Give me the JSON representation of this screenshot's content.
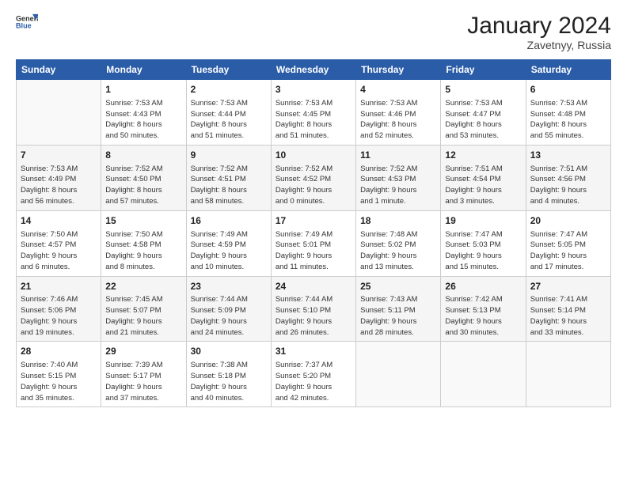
{
  "header": {
    "logo": {
      "general": "General",
      "blue": "Blue"
    },
    "title": "January 2024",
    "location": "Zavetnyy, Russia"
  },
  "columns": [
    "Sunday",
    "Monday",
    "Tuesday",
    "Wednesday",
    "Thursday",
    "Friday",
    "Saturday"
  ],
  "weeks": [
    [
      {
        "day": "",
        "info": ""
      },
      {
        "day": "1",
        "info": "Sunrise: 7:53 AM\nSunset: 4:43 PM\nDaylight: 8 hours\nand 50 minutes."
      },
      {
        "day": "2",
        "info": "Sunrise: 7:53 AM\nSunset: 4:44 PM\nDaylight: 8 hours\nand 51 minutes."
      },
      {
        "day": "3",
        "info": "Sunrise: 7:53 AM\nSunset: 4:45 PM\nDaylight: 8 hours\nand 51 minutes."
      },
      {
        "day": "4",
        "info": "Sunrise: 7:53 AM\nSunset: 4:46 PM\nDaylight: 8 hours\nand 52 minutes."
      },
      {
        "day": "5",
        "info": "Sunrise: 7:53 AM\nSunset: 4:47 PM\nDaylight: 8 hours\nand 53 minutes."
      },
      {
        "day": "6",
        "info": "Sunrise: 7:53 AM\nSunset: 4:48 PM\nDaylight: 8 hours\nand 55 minutes."
      }
    ],
    [
      {
        "day": "7",
        "info": "Sunrise: 7:53 AM\nSunset: 4:49 PM\nDaylight: 8 hours\nand 56 minutes."
      },
      {
        "day": "8",
        "info": "Sunrise: 7:52 AM\nSunset: 4:50 PM\nDaylight: 8 hours\nand 57 minutes."
      },
      {
        "day": "9",
        "info": "Sunrise: 7:52 AM\nSunset: 4:51 PM\nDaylight: 8 hours\nand 58 minutes."
      },
      {
        "day": "10",
        "info": "Sunrise: 7:52 AM\nSunset: 4:52 PM\nDaylight: 9 hours\nand 0 minutes."
      },
      {
        "day": "11",
        "info": "Sunrise: 7:52 AM\nSunset: 4:53 PM\nDaylight: 9 hours\nand 1 minute."
      },
      {
        "day": "12",
        "info": "Sunrise: 7:51 AM\nSunset: 4:54 PM\nDaylight: 9 hours\nand 3 minutes."
      },
      {
        "day": "13",
        "info": "Sunrise: 7:51 AM\nSunset: 4:56 PM\nDaylight: 9 hours\nand 4 minutes."
      }
    ],
    [
      {
        "day": "14",
        "info": "Sunrise: 7:50 AM\nSunset: 4:57 PM\nDaylight: 9 hours\nand 6 minutes."
      },
      {
        "day": "15",
        "info": "Sunrise: 7:50 AM\nSunset: 4:58 PM\nDaylight: 9 hours\nand 8 minutes."
      },
      {
        "day": "16",
        "info": "Sunrise: 7:49 AM\nSunset: 4:59 PM\nDaylight: 9 hours\nand 10 minutes."
      },
      {
        "day": "17",
        "info": "Sunrise: 7:49 AM\nSunset: 5:01 PM\nDaylight: 9 hours\nand 11 minutes."
      },
      {
        "day": "18",
        "info": "Sunrise: 7:48 AM\nSunset: 5:02 PM\nDaylight: 9 hours\nand 13 minutes."
      },
      {
        "day": "19",
        "info": "Sunrise: 7:47 AM\nSunset: 5:03 PM\nDaylight: 9 hours\nand 15 minutes."
      },
      {
        "day": "20",
        "info": "Sunrise: 7:47 AM\nSunset: 5:05 PM\nDaylight: 9 hours\nand 17 minutes."
      }
    ],
    [
      {
        "day": "21",
        "info": "Sunrise: 7:46 AM\nSunset: 5:06 PM\nDaylight: 9 hours\nand 19 minutes."
      },
      {
        "day": "22",
        "info": "Sunrise: 7:45 AM\nSunset: 5:07 PM\nDaylight: 9 hours\nand 21 minutes."
      },
      {
        "day": "23",
        "info": "Sunrise: 7:44 AM\nSunset: 5:09 PM\nDaylight: 9 hours\nand 24 minutes."
      },
      {
        "day": "24",
        "info": "Sunrise: 7:44 AM\nSunset: 5:10 PM\nDaylight: 9 hours\nand 26 minutes."
      },
      {
        "day": "25",
        "info": "Sunrise: 7:43 AM\nSunset: 5:11 PM\nDaylight: 9 hours\nand 28 minutes."
      },
      {
        "day": "26",
        "info": "Sunrise: 7:42 AM\nSunset: 5:13 PM\nDaylight: 9 hours\nand 30 minutes."
      },
      {
        "day": "27",
        "info": "Sunrise: 7:41 AM\nSunset: 5:14 PM\nDaylight: 9 hours\nand 33 minutes."
      }
    ],
    [
      {
        "day": "28",
        "info": "Sunrise: 7:40 AM\nSunset: 5:15 PM\nDaylight: 9 hours\nand 35 minutes."
      },
      {
        "day": "29",
        "info": "Sunrise: 7:39 AM\nSunset: 5:17 PM\nDaylight: 9 hours\nand 37 minutes."
      },
      {
        "day": "30",
        "info": "Sunrise: 7:38 AM\nSunset: 5:18 PM\nDaylight: 9 hours\nand 40 minutes."
      },
      {
        "day": "31",
        "info": "Sunrise: 7:37 AM\nSunset: 5:20 PM\nDaylight: 9 hours\nand 42 minutes."
      },
      {
        "day": "",
        "info": ""
      },
      {
        "day": "",
        "info": ""
      },
      {
        "day": "",
        "info": ""
      }
    ]
  ]
}
